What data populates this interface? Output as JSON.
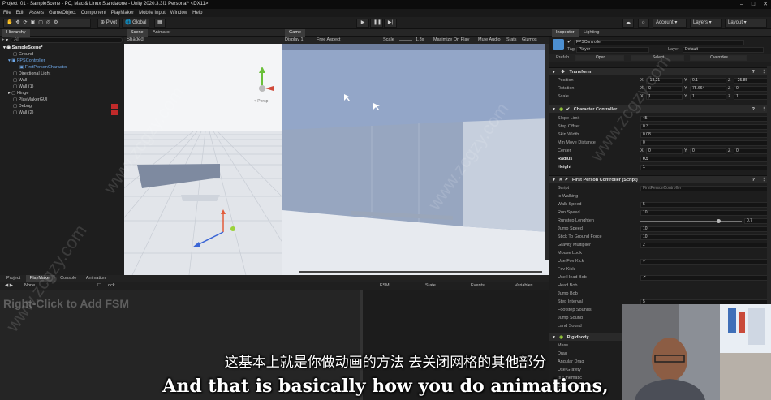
{
  "window": {
    "title": "Project_01 - SampleScene - PC, Mac & Linux Standalone - Unity 2020.3.3f1 Personal* <DX11>"
  },
  "menu": [
    "File",
    "Edit",
    "Assets",
    "GameObject",
    "Component",
    "PlayMaker",
    "Mobile Input",
    "Window",
    "Help"
  ],
  "toolbar": {
    "pivot": "Pivot",
    "global": "Global",
    "account": "Account",
    "layers": "Layers",
    "layout": "Layout"
  },
  "hierarchy": {
    "tab": "Hierarchy",
    "search_placeholder": "All",
    "items": [
      {
        "label": "SampleScene*",
        "indent": 0
      },
      {
        "label": "Ground",
        "indent": 1
      },
      {
        "label": "FPSController",
        "indent": 1
      },
      {
        "label": "FirstPersonCharacter",
        "indent": 2
      },
      {
        "label": "Directional Light",
        "indent": 1
      },
      {
        "label": "Wall",
        "indent": 1
      },
      {
        "label": "Wall (1)",
        "indent": 1
      },
      {
        "label": "Hinge",
        "indent": 1
      },
      {
        "label": "PlayMakerGUI",
        "indent": 1
      },
      {
        "label": "Debug",
        "indent": 1
      },
      {
        "label": "Wall (2)",
        "indent": 1
      }
    ]
  },
  "scene": {
    "tabs": [
      "Scene",
      "Animator"
    ],
    "shading": "Shaded",
    "gizmo_label": "< Persp"
  },
  "game": {
    "tab": "Game",
    "display": "Display 1",
    "aspect": "Free Aspect",
    "scale_label": "Scale",
    "scale_value": "1.3x",
    "options": [
      "Maximize On Play",
      "Mute Audio",
      "Stats",
      "Gizmos"
    ]
  },
  "inspector": {
    "tabs": [
      "Inspector",
      "Lighting"
    ],
    "object_name": "FPSController",
    "tag_label": "Tag",
    "tag_value": "Player",
    "layer_label": "Layer",
    "layer_value": "Default",
    "prefab_label": "Prefab",
    "prefab_buttons": [
      "Open",
      "Select",
      "Overrides"
    ],
    "transform": {
      "title": "Transform",
      "rows": [
        {
          "label": "Position",
          "x": "-18.21",
          "y": "0.1",
          "z": "-25.85"
        },
        {
          "label": "Rotation",
          "x": "0",
          "y": "75.664",
          "z": "0"
        },
        {
          "label": "Scale",
          "x": "1",
          "y": "1",
          "z": "1"
        }
      ]
    },
    "character_controller": {
      "title": "Character Controller",
      "rows": [
        {
          "label": "Slope Limit",
          "value": "45"
        },
        {
          "label": "Step Offset",
          "value": "0.3"
        },
        {
          "label": "Skin Width",
          "value": "0.08"
        },
        {
          "label": "Min Move Distance",
          "value": "0"
        }
      ],
      "center": {
        "label": "Center",
        "x": "0",
        "y": "0",
        "z": "0"
      },
      "radius": {
        "label": "Radius",
        "value": "0.5"
      },
      "height": {
        "label": "Height",
        "value": "1"
      }
    },
    "fps_controller": {
      "title": "First Person Controller (Script)",
      "rows": [
        {
          "label": "Script",
          "value": "FirstPersonController"
        },
        {
          "label": "Is Walking",
          "value": ""
        },
        {
          "label": "Walk Speed",
          "value": "5"
        },
        {
          "label": "Run Speed",
          "value": "10"
        },
        {
          "label": "Runstep Lenghten",
          "value": "0.7"
        },
        {
          "label": "Jump Speed",
          "value": "10"
        },
        {
          "label": "Stick To Ground Force",
          "value": "10"
        },
        {
          "label": "Gravity Multiplier",
          "value": "2"
        },
        {
          "label": "Mouse Look",
          "value": ""
        },
        {
          "label": "Use Fov Kick",
          "value": "✔"
        },
        {
          "label": "Fov Kick",
          "value": ""
        },
        {
          "label": "Use Head Bob",
          "value": "✔"
        },
        {
          "label": "Head Bob",
          "value": ""
        },
        {
          "label": "Jump Bob",
          "value": ""
        },
        {
          "label": "Step Interval",
          "value": "5"
        },
        {
          "label": "Footstep Sounds",
          "value": ""
        },
        {
          "label": "Jump Sound",
          "value": ""
        },
        {
          "label": "Land Sound",
          "value": ""
        }
      ],
      "runstep_slider_fraction": 0.78
    },
    "rigidbody": {
      "title": "Rigidbody",
      "rows": [
        "Mass",
        "Drag",
        "Angular Drag",
        "Use Gravity",
        "Is Kinematic",
        "Collision Detection"
      ]
    }
  },
  "bottom": {
    "tabs": [
      "Project",
      "PlayMaker",
      "Console",
      "Animation"
    ],
    "none_label": "None",
    "lock_label": "Lock",
    "hint": "Right-Click to Add FSM",
    "fsm_tabs": [
      "FSM",
      "State",
      "Events",
      "Variables"
    ]
  },
  "subtitles": {
    "zh": "这基本上就是你做动画的方法 去关闭网格的其他部分",
    "en": "And that is basically how you do animations,"
  },
  "watermark": "www.zcgzy.com",
  "colors": {
    "sky": "#93a6c8",
    "ground": "#e6e9ee",
    "wall": "#7e8aa0",
    "accent_blue": "#2c5d8f",
    "warning_red": "#c02a2a"
  }
}
